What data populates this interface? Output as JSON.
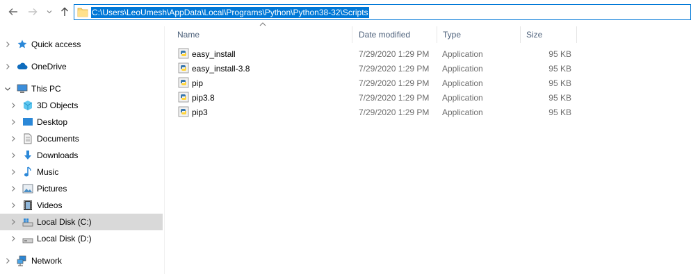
{
  "address_bar": {
    "path": "C:\\Users\\LeoUmesh\\AppData\\Local\\Programs\\Python\\Python38-32\\Scripts"
  },
  "nav_buttons": {
    "back_icon": "arrow-left-icon",
    "forward_icon": "arrow-right-icon",
    "recent_icon": "chevron-down-icon",
    "up_icon": "arrow-up-icon"
  },
  "tree": [
    {
      "label": "Quick access",
      "icon": "star-icon",
      "level": 0
    },
    {
      "label": "OneDrive",
      "icon": "cloud-icon",
      "level": 0
    },
    {
      "label": "This PC",
      "icon": "computer-icon",
      "level": 0,
      "expanded": true
    },
    {
      "label": "3D Objects",
      "icon": "cube-icon",
      "level": 1
    },
    {
      "label": "Desktop",
      "icon": "desktop-icon",
      "level": 1
    },
    {
      "label": "Documents",
      "icon": "document-icon",
      "level": 1
    },
    {
      "label": "Downloads",
      "icon": "download-icon",
      "level": 1
    },
    {
      "label": "Music",
      "icon": "music-icon",
      "level": 1
    },
    {
      "label": "Pictures",
      "icon": "picture-icon",
      "level": 1
    },
    {
      "label": "Videos",
      "icon": "video-icon",
      "level": 1
    },
    {
      "label": "Local Disk (C:)",
      "icon": "drive-icon",
      "level": 1,
      "selected": true
    },
    {
      "label": "Local Disk (D:)",
      "icon": "drive-icon",
      "level": 1
    },
    {
      "label": "Network",
      "icon": "network-icon",
      "level": 0
    }
  ],
  "columns": {
    "name": "Name",
    "date_modified": "Date modified",
    "type": "Type",
    "size": "Size"
  },
  "files": [
    {
      "name": "easy_install",
      "date": "7/29/2020 1:29 PM",
      "type": "Application",
      "size": "95 KB"
    },
    {
      "name": "easy_install-3.8",
      "date": "7/29/2020 1:29 PM",
      "type": "Application",
      "size": "95 KB"
    },
    {
      "name": "pip",
      "date": "7/29/2020 1:29 PM",
      "type": "Application",
      "size": "95 KB"
    },
    {
      "name": "pip3.8",
      "date": "7/29/2020 1:29 PM",
      "type": "Application",
      "size": "95 KB"
    },
    {
      "name": "pip3",
      "date": "7/29/2020 1:29 PM",
      "type": "Application",
      "size": "95 KB"
    }
  ],
  "colors": {
    "accent": "#0078d7",
    "selected_row": "#d9d9d9",
    "header_text": "#4c607a"
  }
}
